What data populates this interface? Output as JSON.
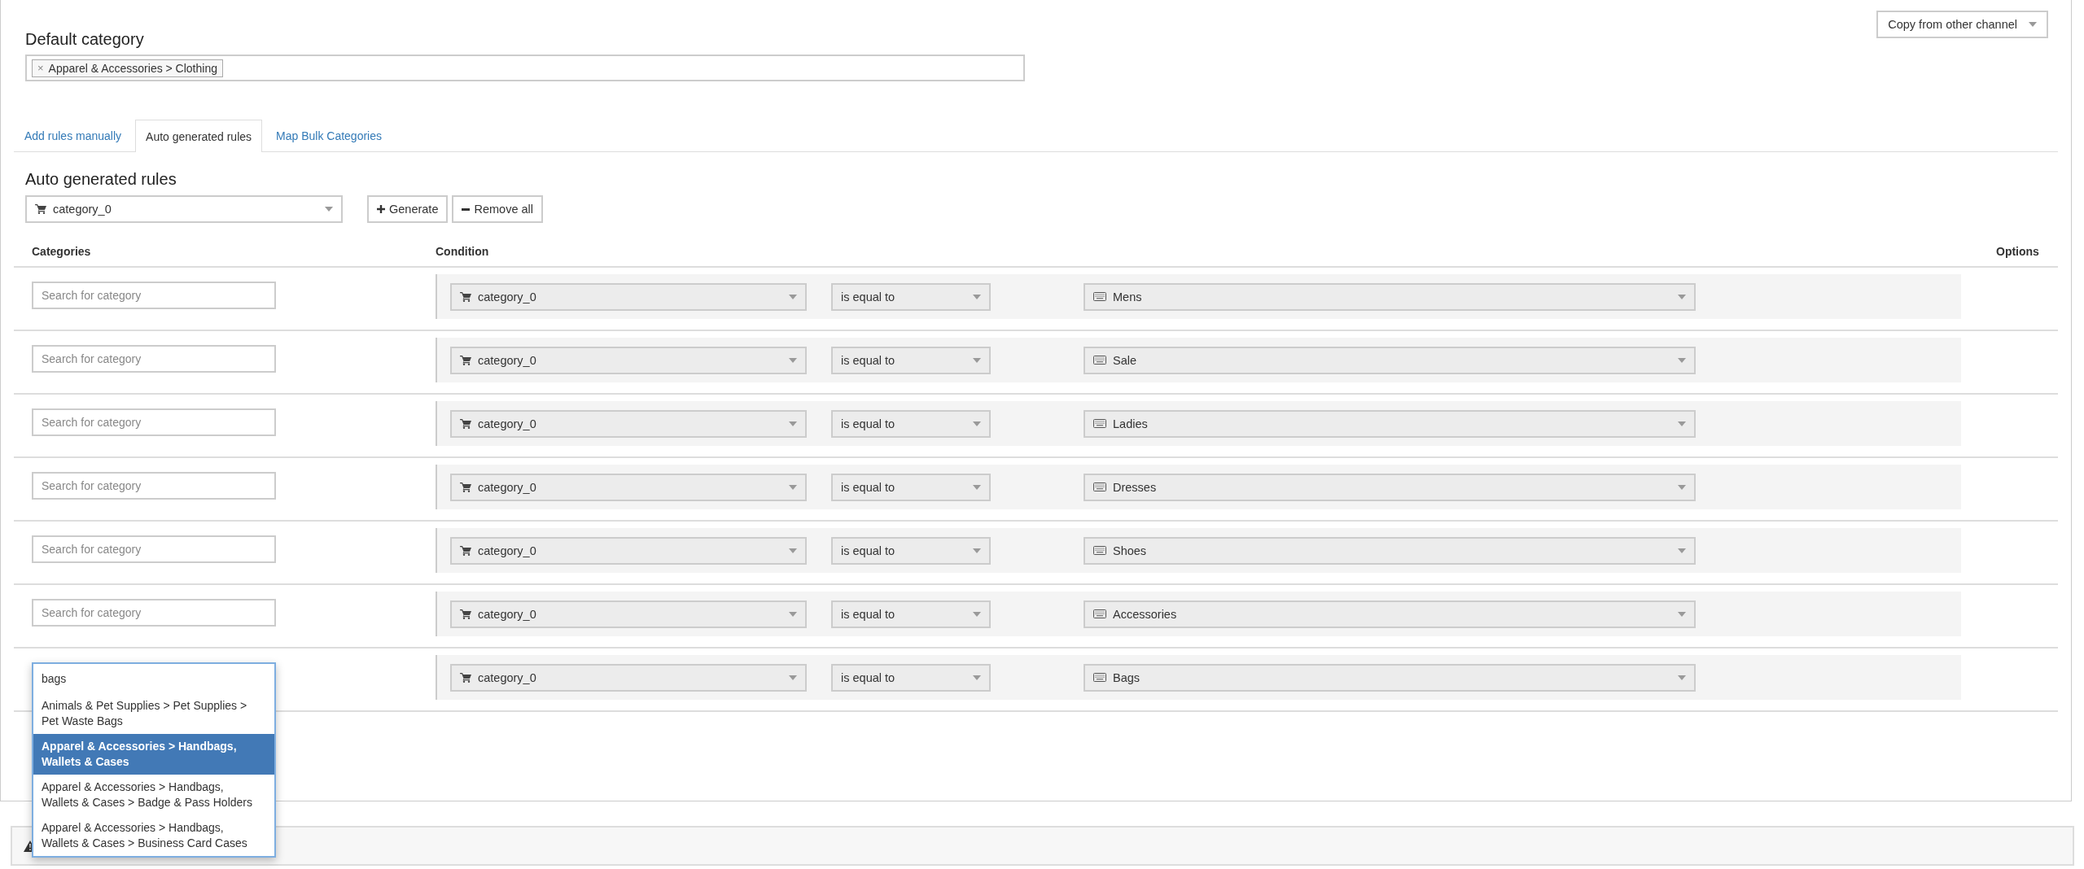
{
  "default_category": {
    "heading": "Default category",
    "tags": [
      {
        "remove": "×",
        "label": "Apparel & Accessories > Clothing"
      }
    ]
  },
  "copy_button": {
    "label": "Copy from other channel"
  },
  "tabs": [
    {
      "label": "Add rules manually",
      "selected": false
    },
    {
      "label": "Auto generated rules",
      "selected": true
    },
    {
      "label": "Map Bulk Categories",
      "selected": false
    }
  ],
  "section": {
    "heading": "Auto generated rules",
    "source_select": "category_0",
    "buttons": [
      {
        "label": "Generate",
        "kind": "add"
      },
      {
        "label": "Remove all",
        "kind": "remove"
      }
    ]
  },
  "table": {
    "columns": [
      "Categories",
      "Condition",
      "Options"
    ],
    "rows": [
      {
        "search_placeholder": "Search for category",
        "field": "category_0",
        "operator": "is equal to",
        "value": "Mens"
      },
      {
        "search_placeholder": "Search for category",
        "field": "category_0",
        "operator": "is equal to",
        "value": "Sale"
      },
      {
        "search_placeholder": "Search for category",
        "field": "category_0",
        "operator": "is equal to",
        "value": "Ladies"
      },
      {
        "search_placeholder": "Search for category",
        "field": "category_0",
        "operator": "is equal to",
        "value": "Dresses"
      },
      {
        "search_placeholder": "Search for category",
        "field": "category_0",
        "operator": "is equal to",
        "value": "Shoes"
      },
      {
        "search_placeholder": "Search for category",
        "field": "category_0",
        "operator": "is equal to",
        "value": "Accessories"
      },
      {
        "search_value": "bags",
        "field": "category_0",
        "operator": "is equal to",
        "value": "Bags",
        "suggestions": [
          {
            "text": "Animals & Pet Supplies > Pet Supplies > Pet Waste Bags",
            "selected": false
          },
          {
            "text": "Apparel & Accessories > Handbags, Wallets & Cases",
            "selected": true
          },
          {
            "text": "Apparel & Accessories > Handbags, Wallets & Cases > Badge & Pass Holders",
            "selected": false
          },
          {
            "text": "Apparel & Accessories > Handbags, Wallets & Cases > Business Card Cases",
            "selected": false
          }
        ]
      }
    ]
  },
  "alert": {
    "kind": "warning"
  }
}
